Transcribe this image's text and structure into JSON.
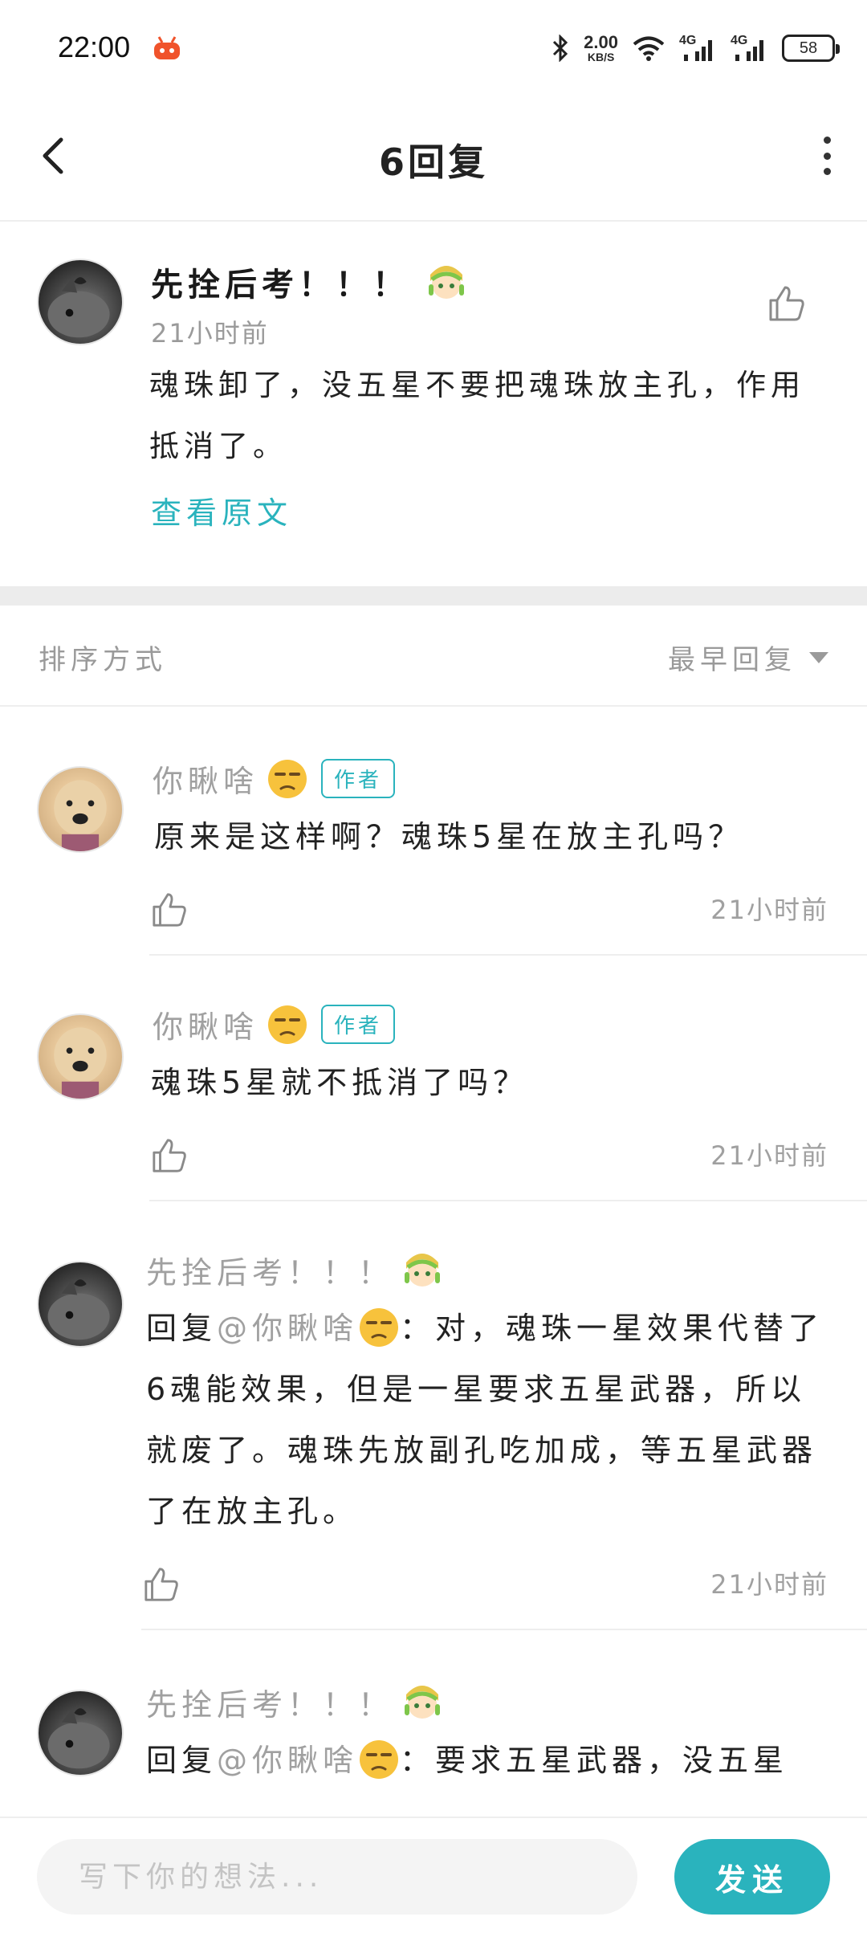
{
  "status_bar": {
    "time": "22:00",
    "net_speed_value": "2.00",
    "net_speed_unit": "KB/S",
    "signal_1_label": "4G",
    "signal_2_label": "4G",
    "battery": "58"
  },
  "header": {
    "title": "6回复"
  },
  "main_post": {
    "author": "先拴后考！！！",
    "time": "21小时前",
    "body": "魂珠卸了，没五星不要把魂珠放主孔，作用抵消了。",
    "view_original": "查看原文"
  },
  "sort": {
    "label": "排序方式",
    "selected": "最早回复"
  },
  "replies": [
    {
      "author": "你瞅啥",
      "tag": "作者",
      "text": "原来是这样啊？魂珠5星在放主孔吗？",
      "time": "21小时前"
    },
    {
      "author": "你瞅啥",
      "tag": "作者",
      "text": "魂珠5星就不抵消了吗？",
      "time": "21小时前"
    },
    {
      "author": "先拴后考！！！",
      "reply_prefix": "回复",
      "mention": "@你瞅啥",
      "text": "：对，魂珠一星效果代替了6魂能效果，但是一星要求五星武器，所以就废了。魂珠先放副孔吃加成，等五星武器了在放主孔。",
      "time": "21小时前"
    },
    {
      "author": "先拴后考！！！",
      "reply_prefix": "回复",
      "mention": "@你瞅啥",
      "text": "：要求五星武器，没五星",
      "time": ""
    }
  ],
  "input": {
    "placeholder": "写下你的想法...",
    "send_label": "发送"
  },
  "colors": {
    "accent": "#2ab3bd",
    "muted_text": "#a0a0a0",
    "divider": "#ececec"
  }
}
